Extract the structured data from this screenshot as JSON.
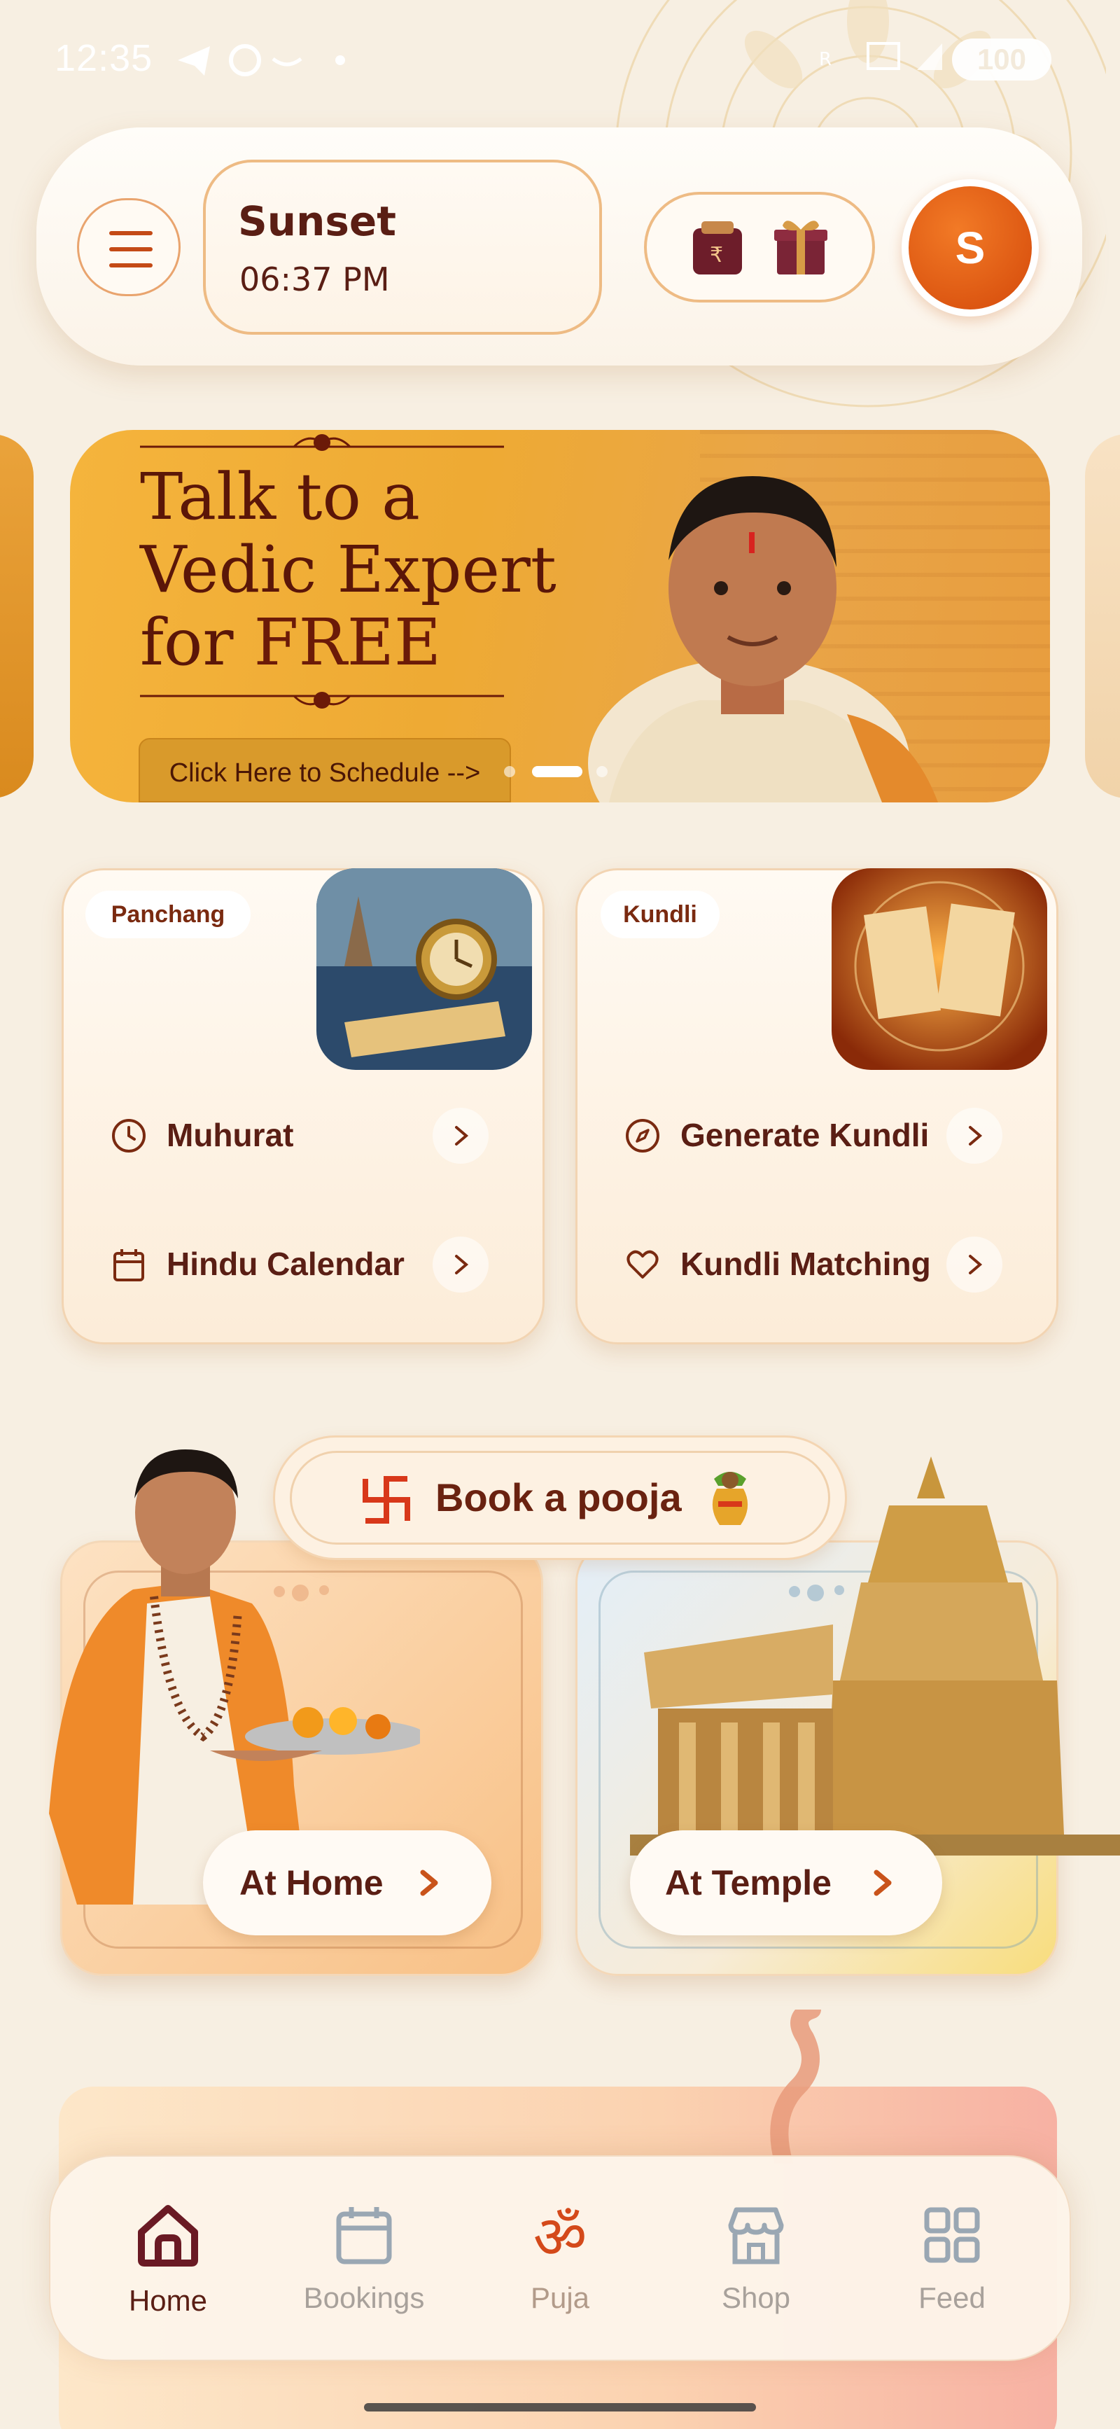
{
  "status_bar": {
    "time": "12:35",
    "battery": "100"
  },
  "header": {
    "sunset_label": "Sunset",
    "sunset_time": "06:37 PM",
    "avatar_initial": "S"
  },
  "banner": {
    "title_line1": "Talk to a",
    "title_line2": "Vedic Expert",
    "title_line3a": "for ",
    "title_line3b": "FREE",
    "cta": "Click Here to Schedule -->",
    "active_slide": 2,
    "slide_count": 3
  },
  "panchang": {
    "chip": "Panchang",
    "items": [
      {
        "label": "Muhurat",
        "icon": "clock-icon"
      },
      {
        "label": "Hindu Calendar",
        "icon": "calendar-icon"
      }
    ]
  },
  "kundli": {
    "chip": "Kundli",
    "items": [
      {
        "label": "Generate Kundli",
        "icon": "compass-icon"
      },
      {
        "label": "Kundli Matching",
        "icon": "heart-icon"
      }
    ]
  },
  "pooja": {
    "title": "Book a pooja",
    "home_label": "At Home",
    "temple_label": "At Temple"
  },
  "bottom_nav": [
    {
      "label": "Home",
      "icon": "home-icon",
      "active": true
    },
    {
      "label": "Bookings",
      "icon": "calendar-icon",
      "active": false
    },
    {
      "label": "Puja",
      "icon": "om-icon",
      "active": false
    },
    {
      "label": "Shop",
      "icon": "store-icon",
      "active": false
    },
    {
      "label": "Feed",
      "icon": "grid-icon",
      "active": false
    }
  ],
  "colors": {
    "brand": "#d4490a",
    "text_dark": "#5a1e14",
    "background": "#f7efe2"
  }
}
